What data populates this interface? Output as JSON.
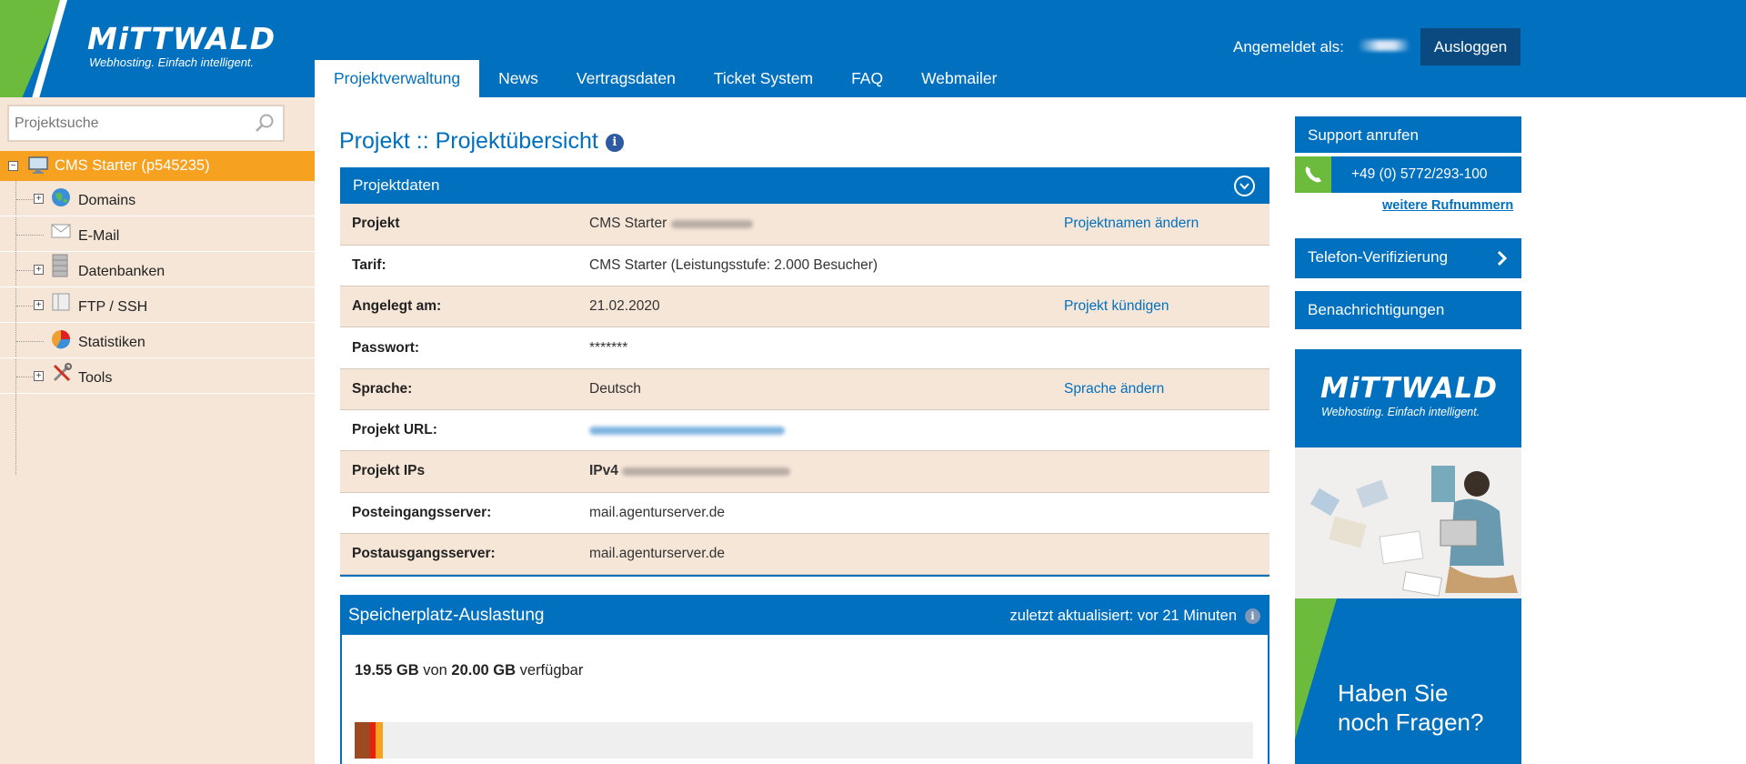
{
  "header": {
    "logo_brand": "MiTTWALD",
    "logo_tagline": "Webhosting. Einfach intelligent.",
    "login_label": "Angemeldet als:",
    "logout_label": "Ausloggen",
    "tabs": [
      {
        "label": "Projektverwaltung",
        "active": true
      },
      {
        "label": "News"
      },
      {
        "label": "Vertragsdaten"
      },
      {
        "label": "Ticket System"
      },
      {
        "label": "FAQ"
      },
      {
        "label": "Webmailer"
      }
    ]
  },
  "sidebar": {
    "search_placeholder": "Projektsuche",
    "root_label": "CMS Starter (p545235)",
    "items": [
      {
        "label": "Domains",
        "icon": "globe-icon"
      },
      {
        "label": "E-Mail",
        "icon": "envelope-icon"
      },
      {
        "label": "Datenbanken",
        "icon": "database-icon"
      },
      {
        "label": "FTP / SSH",
        "icon": "folder-icon"
      },
      {
        "label": "Statistiken",
        "icon": "pie-chart-icon"
      },
      {
        "label": "Tools",
        "icon": "tools-icon"
      }
    ]
  },
  "main": {
    "page_title": "Projekt :: Projektübersicht",
    "panel_title": "Projektdaten",
    "rows": [
      {
        "key": "Projekt",
        "value": "CMS Starter",
        "action": "Projektnamen ändern"
      },
      {
        "key": "Tarif:",
        "value": "CMS Starter (Leistungsstufe: 2.000 Besucher)",
        "action": ""
      },
      {
        "key": "Angelegt am:",
        "value": "21.02.2020",
        "action": "Projekt kündigen"
      },
      {
        "key": "Passwort:",
        "value": "*******",
        "action": ""
      },
      {
        "key": "Sprache:",
        "value": "Deutsch",
        "action": "Sprache ändern"
      },
      {
        "key": "Projekt URL:",
        "value": "",
        "action": ""
      },
      {
        "key": "Projekt IPs",
        "value": "IPv4",
        "action": ""
      },
      {
        "key": "Posteingangsserver:",
        "value": "mail.agenturserver.de",
        "action": ""
      },
      {
        "key": "Postausgangsserver:",
        "value": "mail.agenturserver.de",
        "action": ""
      }
    ],
    "storage": {
      "title": "Speicherplatz-Auslastung",
      "updated": "zuletzt aktualisiert: vor 21 Minuten",
      "free": "19.55 GB",
      "of": "von",
      "total": "20.00 GB",
      "available": "verfügbar",
      "usage_segments": [
        {
          "fraction": 0.0172,
          "color": "#9c4a22"
        },
        {
          "fraction": 0.0061,
          "color": "#e8200c"
        },
        {
          "fraction": 0.0081,
          "color": "#f7a120"
        }
      ]
    }
  },
  "right": {
    "support_title": "Support anrufen",
    "phone_number": "+49 (0) 5772/293-100",
    "more_numbers": "weitere Rufnummern",
    "verify_label": "Telefon-Verifizierung",
    "notifications_label": "Benachrichtigungen",
    "ad_brand": "MiTTWALD",
    "ad_tagline": "Webhosting. Einfach intelligent.",
    "ad_line1": "Haben Sie",
    "ad_line2": "noch Fragen?"
  },
  "colors": {
    "primary": "#0070bf",
    "accent_green": "#6cbb3c",
    "accent_orange": "#f7a120",
    "sidebar_bg": "#f6e6d8"
  }
}
